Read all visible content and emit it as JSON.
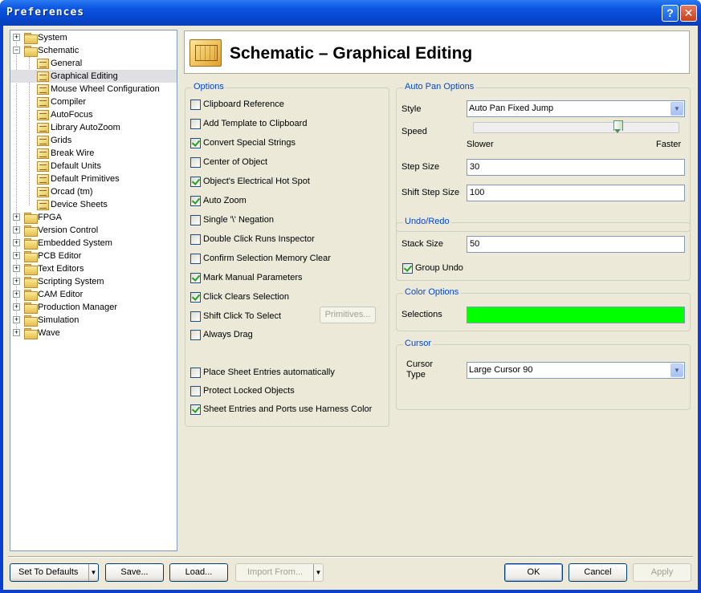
{
  "window": {
    "title": "Preferences",
    "help_label": "?",
    "close_label": "✕"
  },
  "tree": {
    "items": [
      {
        "label": "System",
        "expander": "+"
      },
      {
        "label": "Schematic",
        "expander": "−"
      },
      {
        "label": "General"
      },
      {
        "label": "Graphical Editing",
        "selected": true
      },
      {
        "label": "Mouse Wheel Configuration"
      },
      {
        "label": "Compiler"
      },
      {
        "label": "AutoFocus"
      },
      {
        "label": "Library AutoZoom"
      },
      {
        "label": "Grids"
      },
      {
        "label": "Break Wire"
      },
      {
        "label": "Default Units"
      },
      {
        "label": "Default Primitives"
      },
      {
        "label": "Orcad (tm)"
      },
      {
        "label": "Device Sheets"
      },
      {
        "label": "FPGA",
        "expander": "+"
      },
      {
        "label": "Version Control",
        "expander": "+"
      },
      {
        "label": "Embedded System",
        "expander": "+"
      },
      {
        "label": "PCB Editor",
        "expander": "+"
      },
      {
        "label": "Text Editors",
        "expander": "+"
      },
      {
        "label": "Scripting System",
        "expander": "+"
      },
      {
        "label": "CAM Editor",
        "expander": "+"
      },
      {
        "label": "Production Manager",
        "expander": "+"
      },
      {
        "label": "Simulation",
        "expander": "+"
      },
      {
        "label": "Wave",
        "expander": "+"
      }
    ]
  },
  "header": {
    "title": "Schematic – Graphical Editing"
  },
  "options": {
    "title": "Options",
    "items": [
      {
        "label": "Clipboard Reference",
        "checked": false
      },
      {
        "label": "Add Template to Clipboard",
        "checked": false
      },
      {
        "label": "Convert Special Strings",
        "checked": true
      },
      {
        "label": "Center of Object",
        "checked": false
      },
      {
        "label": "Object's Electrical Hot Spot",
        "checked": true
      },
      {
        "label": "Auto Zoom",
        "checked": true
      },
      {
        "label": "Single '\\' Negation",
        "checked": false
      },
      {
        "label": "Double Click Runs Inspector",
        "checked": false
      },
      {
        "label": "Confirm Selection Memory Clear",
        "checked": false
      },
      {
        "label": "Mark Manual Parameters",
        "checked": true
      },
      {
        "label": "Click Clears Selection",
        "checked": true
      },
      {
        "label": "Shift Click To Select",
        "checked": false
      },
      {
        "label": "Always Drag",
        "checked": false
      },
      {
        "label": "Place Sheet Entries automatically",
        "checked": false
      },
      {
        "label": "Protect Locked Objects",
        "checked": false
      },
      {
        "label": "Sheet Entries and Ports use Harness Color",
        "checked": true
      }
    ],
    "primitives_button": "Primitives..."
  },
  "autopan": {
    "title": "Auto Pan Options",
    "style_label": "Style",
    "style_value": "Auto Pan Fixed Jump",
    "speed_label": "Speed",
    "speed_level": 0.7,
    "slower_label": "Slower",
    "faster_label": "Faster",
    "step_label": "Step Size",
    "step_value": "30",
    "shift_step_label": "Shift Step Size",
    "shift_step_value": "100"
  },
  "undo": {
    "title": "Undo/Redo",
    "stack_label": "Stack Size",
    "stack_value": "50",
    "group_undo_label": "Group Undo",
    "group_undo_checked": true
  },
  "color_options": {
    "title": "Color Options",
    "selections_label": "Selections",
    "selections_color": "#00ff00"
  },
  "cursor": {
    "title": "Cursor",
    "type_label_1": "Cursor",
    "type_label_2": "Type",
    "type_value": "Large Cursor 90"
  },
  "footer": {
    "set_defaults": "Set To Defaults",
    "save": "Save...",
    "load": "Load...",
    "import_from": "Import From...",
    "ok": "OK",
    "cancel": "Cancel",
    "apply": "Apply"
  },
  "icons": {
    "expander": "▸",
    "dropdown": "chevron-down-icon"
  }
}
